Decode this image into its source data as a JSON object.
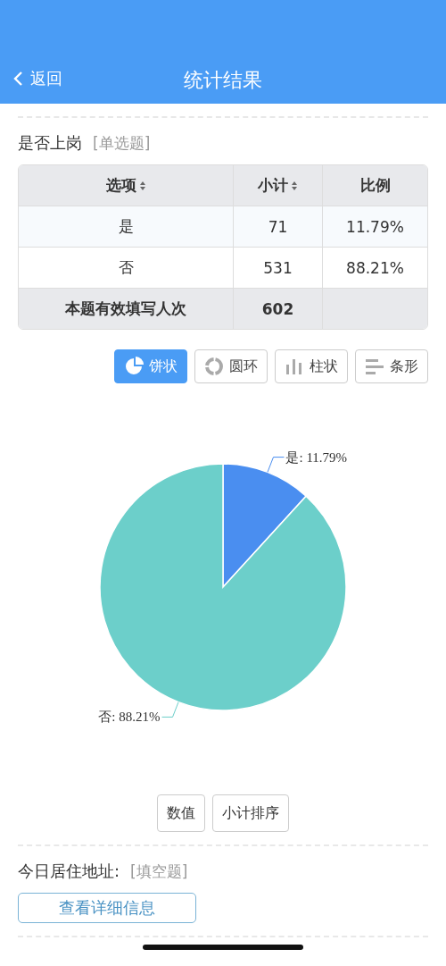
{
  "nav_bar": {
    "back": "返回",
    "title": "统计结果"
  },
  "question": {
    "title": "是否上岗",
    "type": "[单选题]"
  },
  "table": {
    "columns": [
      {
        "label": "选项",
        "sortable": true
      },
      {
        "label": "小计",
        "sortable": true
      },
      {
        "label": "比例",
        "sortable": false
      }
    ],
    "rows": [
      [
        "是",
        "71",
        "11.79%"
      ],
      [
        "否",
        "531",
        "88.21%"
      ]
    ],
    "total": {
      "label": "本题有效填写人次",
      "count": "602"
    }
  },
  "chart_types": [
    {
      "kind": "pie",
      "label": "饼状",
      "selected": true
    },
    {
      "kind": "ring",
      "label": "圆环",
      "selected": false
    },
    {
      "kind": "column",
      "label": "柱状",
      "selected": false
    },
    {
      "kind": "bar",
      "label": "条形",
      "selected": false
    }
  ],
  "chart": {
    "chart_data": {
      "type": "pie",
      "values": [
        11.79,
        88.21
      ]
    },
    "slice_labels": [
      "是: 11.79%",
      "否: 88.21%"
    ]
  },
  "chart_actions": [
    "数值",
    "小计排序"
  ],
  "question_2": {
    "title": "今日居住地址:",
    "type": "[填空题]",
    "button": "查看详细信息"
  }
}
